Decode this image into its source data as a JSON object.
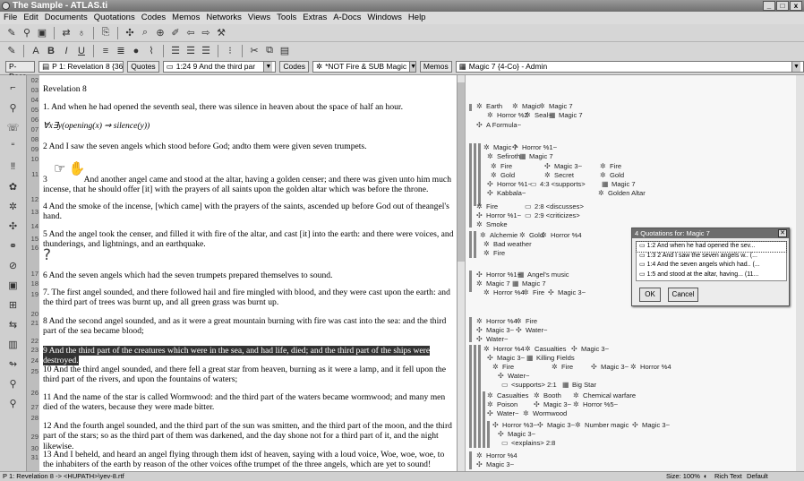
{
  "window": {
    "title": "The Sample - ATLAS.ti",
    "buttons": [
      "_",
      "□",
      "x"
    ]
  },
  "menu": [
    "File",
    "Edit",
    "Documents",
    "Quotations",
    "Codes",
    "Memos",
    "Networks",
    "Views",
    "Tools",
    "Extras",
    "A-Docs",
    "Windows",
    "Help"
  ],
  "selectors": {
    "pdocs_label": "P-Docs",
    "pdoc_value": "P 1: Revelation 8 {36}~",
    "quotes_label": "Quotes",
    "quote_value": "1:24 9 And the third par",
    "codes_label": "Codes",
    "code_value": "*NOT Fire & SUB Magic",
    "memos_label": "Memos",
    "memo_value": "Magic 7 {4-Co} - Admin"
  },
  "line_numbers": [
    "02",
    "03",
    "04",
    "05",
    "06",
    "07",
    "08",
    "09",
    "10",
    "11",
    "12",
    "13",
    "14",
    "15",
    "16",
    "17",
    "18",
    "19",
    "20",
    "21",
    "22",
    "23",
    "24",
    "25",
    "26",
    "27",
    "28",
    "29",
    "30",
    "31"
  ],
  "document": {
    "heading": "Revelation  8",
    "formula": "∀x∃y(opening(x) ⇒ silence(y))",
    "paragraphs": [
      "1. And when he had opened the seventh seal, there was silence in heaven about the space of half an hour.",
      "2  And I saw the seven angels which stood before God; andto them were given seven trumpets.",
      "And another angel came and stood at the altar, having a golden censer; and there was given unto him much incense, that he should offer [it] with the prayers of all saints upon the golden altar which was before the throne.",
      "4  And the smoke of the incense, [which came] with the prayers of the saints, ascended up before God out of theangel's hand.",
      "5  And the angel took the censer, and filled it with fire of the altar, and cast [it] into the earth: and there were voices, and thunderings, and lightnings, and an earthquake.",
      "6  And the seven angels which had the seven trumpets prepared themselves to sound.",
      "7. The first angel sounded, and there followed hail and fire mingled with blood, and they were cast upon the earth: and the third part of trees was burnt up, and all green grass was burnt up.",
      "8  And the second angel sounded, and as it were a great mountain burning with fire was cast into the sea: and the third part of the sea became blood;",
      "9  And the third part of the creatures which were in the sea, and had life, died; and the third part of the ships were destroyed.",
      "10  And the third angel sounded, and there fell a great star from heaven, burning as it were a lamp, and it fell upon the third part of the rivers, and upon the fountains of waters;",
      "11  And the name of the star is called Wormwood: and the third part of the waters became wormwood; and many men died of the waters, because they were made bitter.",
      "12  And the fourth angel sounded, and the third part of the sun was smitten, and the third part of the moon, and the third part of the stars; so as the third part of them was darkened, and the day shone not for a third part of it, and the night likewise.",
      "13  And I beheld, and heard an angel flying through them idst of heaven, saying with a loud voice, Woe, woe, woe, to the inhabiters of the earth by reason of the other voices ofthe trumpet of the three angels, which are yet to sound!"
    ],
    "para3_num": "3"
  },
  "margin_items": [
    "Earth",
    "Magic",
    "Magic 7",
    "Horror %2",
    "Seal~",
    "Magic 7",
    "A Formula~",
    "Magic 7",
    "Horror %1~",
    "Sefiroth",
    "Magic 7",
    "Fire",
    "Magic 3~",
    "Fire",
    "Gold",
    "Secret",
    "Gold",
    "Horror %1~",
    "4:3 <supports>",
    "Magic 7",
    "Kabbala~",
    "Golden Altar",
    "Fire",
    "2:8 <discusses>",
    "Horror %1~",
    "2:9 <criticizes>",
    "Smoke",
    "Alchemie",
    "Gold",
    "Horror %4",
    "Bad weather",
    "Fire",
    "Horror %1~",
    "Angel's music",
    "Magic 7",
    "Magic 7",
    "Horror %4",
    "Fire",
    "Magic 3~",
    "Horror %4",
    "Fire",
    "Magic 3~",
    "Water~",
    "Water~",
    "Horror %4",
    "Casualties",
    "Magic 3~",
    "Magic 3~",
    "Killing Fields",
    "Fire",
    "Fire",
    "Magic 3~",
    "Horror %4",
    "Water~",
    "<supports> 2:1",
    "Big Star",
    "Casualties",
    "Booth",
    "Chemical warfare",
    "Poison",
    "Magic 3~",
    "Horror %5~",
    "Water~",
    "Wormwood",
    "Horror %3~",
    "Magic 3~",
    "Number magic",
    "Magic 3~",
    "Magic 3~",
    "<explains> 2:8",
    "Horror %4",
    "Magic 3~"
  ],
  "dialog": {
    "title": "4 Quotations for: Magic 7",
    "items": [
      "1:2 And when he had opened the sev...",
      "1:3 2 And I saw the seven angels w.. (...",
      "1:4 And the seven angels which had.. (...",
      "1:5 and stood at the altar, having... (11..."
    ],
    "ok": "OK",
    "cancel": "Cancel"
  },
  "status": {
    "left": "P 1: Revelation 8 -> <HUPATH>\\yev-8.rtf",
    "size": "Size: 100%",
    "rich": "Rich Text",
    "default": "Default"
  }
}
